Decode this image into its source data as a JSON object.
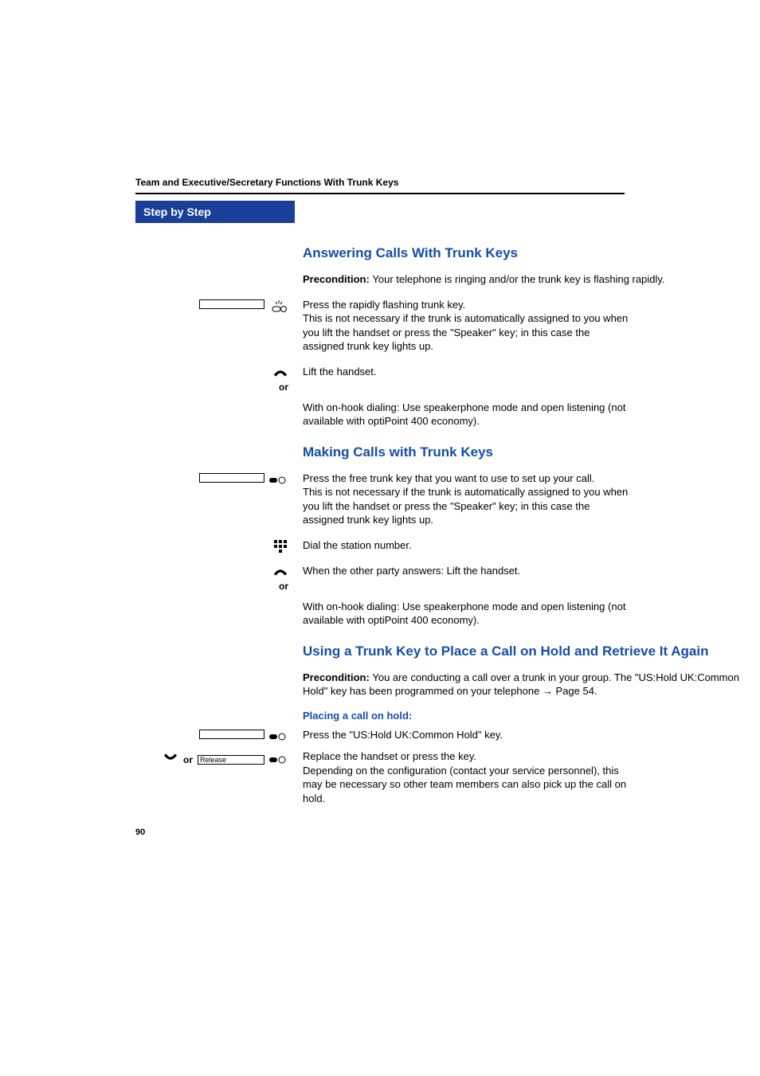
{
  "header": "Team and Executive/Secretary Functions With Trunk Keys",
  "sidebar_title": "Step by Step",
  "sections": {
    "ans": {
      "title": "Answering Calls With Trunk Keys",
      "pre_label": "Precondition: ",
      "pre_text": "Your telephone is ringing and/or the trunk key is flashing rapidly.",
      "step1": "Press the rapidly flashing trunk key.\nThis is not necessary if the trunk is automatically assigned to you when you lift the handset or press the \"Speaker\" key; in this case the assigned trunk key lights up.",
      "step2": "Lift the handset.",
      "or": "or",
      "step3": "With on-hook dialing: Use speakerphone mode and open listening (not available with optiPoint 400 economy)."
    },
    "make": {
      "title": "Making Calls with Trunk Keys",
      "step1": "Press the free trunk key that you want to use to set up your call.\nThis is not necessary if the trunk is automatically assigned to you when you lift the handset or press the \"Speaker\" key; in this case the assigned trunk key lights up.",
      "step2": "Dial the station number.",
      "step3": "When the other party answers: Lift the handset.",
      "or": "or",
      "step4": "With on-hook dialing: Use speakerphone mode and open listening (not available with optiPoint 400 economy)."
    },
    "hold": {
      "title": "Using a Trunk Key to Place a Call on Hold and Retrieve It Again",
      "pre_label": "Precondition: ",
      "pre_text": "You are conducting a call over a trunk in your group. The \"US:Hold UK:Common Hold\" key has been programmed on your telephone ",
      "pre_link": "→ Page 54.",
      "sub": "Placing a call on hold:",
      "step1": "Press the \"US:Hold UK:Common Hold\" key.",
      "or": "or",
      "release_label": "Release",
      "step2": "Replace the handset or press the key.\nDepending on the configuration (contact your service personnel), this may be necessary so other team members can also pick up the call on hold."
    }
  },
  "page_num": "90"
}
